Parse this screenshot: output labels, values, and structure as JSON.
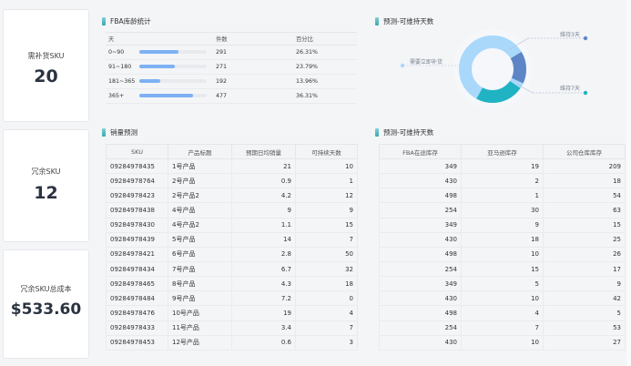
{
  "kpis": [
    {
      "label": "需补货SKU",
      "value": "20"
    },
    {
      "label": "冗余SKU",
      "value": "12"
    },
    {
      "label": "冗余SKU总成本",
      "value": "$533.60"
    }
  ],
  "fba_age": {
    "title": "FBA库龄统计",
    "headers": [
      "天",
      "件数",
      "百分比"
    ],
    "rows": [
      {
        "range": "0~90",
        "count": "291",
        "pct": "26.31%",
        "share": 0.2631
      },
      {
        "range": "91~180",
        "count": "271",
        "pct": "23.79%",
        "share": 0.2379
      },
      {
        "range": "181~365",
        "count": "192",
        "pct": "13.96%",
        "share": 0.1396
      },
      {
        "range": "365+",
        "count": "477",
        "pct": "36.31%",
        "share": 0.3631
      }
    ]
  },
  "donut": {
    "title": "预测-可维持天数",
    "labels": {
      "need": "需要立即补货",
      "d3": "维持3天",
      "d7": "维持7天"
    },
    "colors": {
      "outer_light": "#a9d8fb",
      "teal": "#20b3c4",
      "blue": "#5e86c6"
    }
  },
  "sales": {
    "title": "销量预测",
    "headers": [
      "SKU",
      "产品标题",
      "预期日均销量",
      "可持续天数"
    ],
    "rows": [
      [
        "09284978435",
        "1号产品",
        "21",
        "10"
      ],
      [
        "09284978764",
        "2号产品",
        "0.9",
        "1"
      ],
      [
        "09284978423",
        "2号产品2",
        "4.2",
        "12"
      ],
      [
        "09284978438",
        "4号产品",
        "9",
        "9"
      ],
      [
        "09284978430",
        "4号产品2",
        "1.1",
        "15"
      ],
      [
        "09284978439",
        "5号产品",
        "14",
        "7"
      ],
      [
        "09284978421",
        "6号产品",
        "2.8",
        "50"
      ],
      [
        "09284978434",
        "7号产品",
        "6.7",
        "32"
      ],
      [
        "09284978465",
        "8号产品",
        "4.3",
        "18"
      ],
      [
        "09284978484",
        "9号产品",
        "7.2",
        "0"
      ],
      [
        "09284978476",
        "10号产品",
        "19",
        "4"
      ],
      [
        "09284978433",
        "11号产品",
        "3.4",
        "7"
      ],
      [
        "09284978453",
        "12号产品",
        "0.6",
        "3"
      ]
    ]
  },
  "stock": {
    "title": "预测-可维持天数",
    "headers": [
      "FBA在途库存",
      "亚马逊库存",
      "公司仓库库存"
    ],
    "rows": [
      [
        "349",
        "19",
        "209"
      ],
      [
        "430",
        "2",
        "18"
      ],
      [
        "498",
        "1",
        "54"
      ],
      [
        "254",
        "30",
        "63"
      ],
      [
        "349",
        "9",
        "15"
      ],
      [
        "430",
        "18",
        "25"
      ],
      [
        "498",
        "10",
        "26"
      ],
      [
        "254",
        "15",
        "17"
      ],
      [
        "349",
        "5",
        "9"
      ],
      [
        "430",
        "10",
        "42"
      ],
      [
        "498",
        "4",
        "5"
      ],
      [
        "254",
        "7",
        "53"
      ],
      [
        "430",
        "10",
        "27"
      ]
    ]
  }
}
